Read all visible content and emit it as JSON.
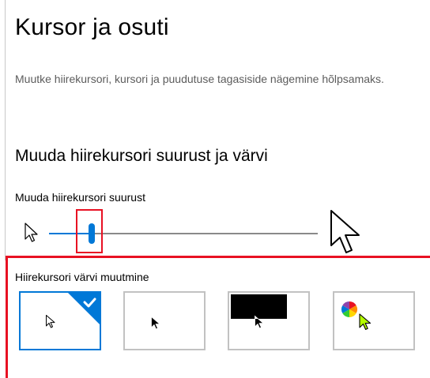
{
  "page": {
    "title": "Kursor ja osuti",
    "description": "Muutke hiirekursori, kursori ja puudutuse tagasiside nägemine hõlpsamaks."
  },
  "pointer_section": {
    "title": "Muuda hiirekursori suurust ja värvi",
    "size_label": "Muuda hiirekursori suurust",
    "size_slider": {
      "value_fraction": 0.16
    }
  },
  "color_section": {
    "label": "Hiirekursori värvi muutmine",
    "options": [
      {
        "id": "white",
        "icon": "white-pointer-icon",
        "selected": true
      },
      {
        "id": "black",
        "icon": "black-pointer-icon",
        "selected": false
      },
      {
        "id": "inverted",
        "icon": "inverted-pointer-icon",
        "selected": false
      },
      {
        "id": "custom",
        "icon": "custom-color-pointer-icon",
        "selected": false
      }
    ]
  },
  "colors": {
    "accent": "#0078d7",
    "highlight": "#e81123",
    "custom_pointer": "#b4ff00"
  }
}
